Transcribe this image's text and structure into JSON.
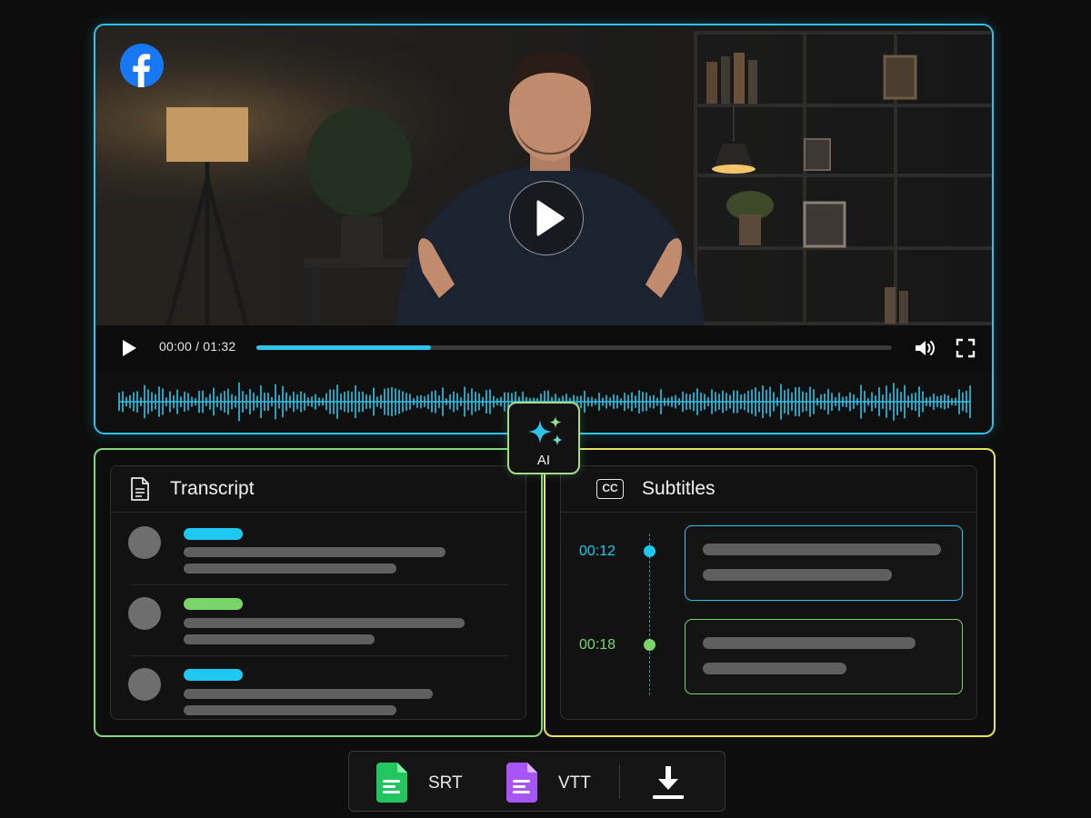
{
  "player": {
    "time": "00:00 / 01:32",
    "progress_fraction": 0.275,
    "brand_color": "#1877F2",
    "accent_color": "#2ec4ea",
    "icons": [
      "facebook-logo-icon",
      "play-overlay-icon",
      "play-icon",
      "volume-icon",
      "fullscreen-icon"
    ]
  },
  "ai_badge": {
    "label": "AI",
    "icon": "sparkles-icon"
  },
  "transcript": {
    "title": "Transcript",
    "icon": "document-icon",
    "rows": [
      {
        "name_color": "#1ec8f0"
      },
      {
        "name_color": "#7ad46a"
      },
      {
        "name_color": "#1ec8f0"
      }
    ]
  },
  "subtitles": {
    "title": "Subtitles",
    "icon": "cc-icon",
    "cc_text": "CC",
    "cues": [
      {
        "time": "00:12",
        "color": "#1ec8f0"
      },
      {
        "time": "00:18",
        "color": "#7ad46a"
      }
    ]
  },
  "export": {
    "formats": [
      {
        "label": "SRT",
        "icon": "srt-file-icon",
        "color": "#22c55e"
      },
      {
        "label": "VTT",
        "icon": "vtt-file-icon",
        "color": "#a855f7"
      }
    ],
    "download_icon": "download-icon"
  }
}
